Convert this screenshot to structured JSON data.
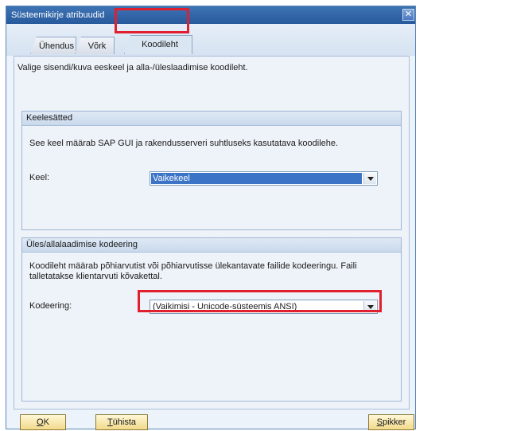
{
  "window": {
    "title": "Süsteemikirje atribuudid",
    "close_glyph": "✕"
  },
  "tabs": [
    {
      "label": "Ühendus"
    },
    {
      "label": "Võrk"
    },
    {
      "label": "Koodileht",
      "active": true
    }
  ],
  "intro_text": "Valige sisendi/kuva eeskeel ja alla-/üleslaadimise koodileht.",
  "language_group": {
    "header": "Keelesätted",
    "description": "See keel määrab SAP GUI ja rakendusserveri suhtluseks kasutatava koodilehe.",
    "field_label": "Keel:",
    "value": "Vaikekeel"
  },
  "encoding_group": {
    "header": "Üles/allalaadimise kodeering",
    "description": "Koodileht määrab põhiarvutist või põhiarvutisse ülekantavate failide kodeeringu. Faili talletatakse klientarvuti kõvakettal.",
    "field_label": "Kodeering:",
    "value": "(Vaikimisi - Unicode-süsteemis ANSI)"
  },
  "buttons": {
    "ok": {
      "mnemonic": "O",
      "rest": "K"
    },
    "cancel": {
      "mnemonic": "T",
      "rest": "ühista"
    },
    "help": {
      "mnemonic": "S",
      "rest": "pikker"
    }
  },
  "colors": {
    "highlight": "#e0202e",
    "titlebar": "#275a9d",
    "selection": "#3b73c6"
  }
}
